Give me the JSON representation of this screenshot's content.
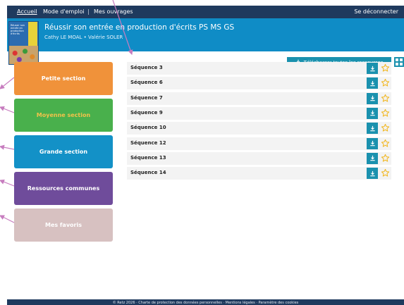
{
  "topnav": {
    "accueil": "Accueil",
    "separator": "|",
    "mode_emploi": "Mode d'emploi",
    "mes_ouvrages": "Mes ouvrages",
    "logout": "Se déconnecter"
  },
  "header": {
    "cover_text": "Réussir son entrée en production d'écrits",
    "title": "Réussir son entrée en production d'écrits PS MS GS",
    "authors": "Cathy LE MOAL • Valérie SOLER"
  },
  "download_all": {
    "label": "Télécharger toutes les ressources",
    "icon": "download-icon"
  },
  "sections": [
    {
      "label": "Petite section",
      "bg": "#f0923a",
      "color": "#ffffff"
    },
    {
      "label": "Moyenne section",
      "bg": "#49b04c",
      "color": "#f2c24a"
    },
    {
      "label": "Grande section",
      "bg": "#1391c7",
      "color": "#ffffff"
    },
    {
      "label": "Ressources communes",
      "bg": "#6f4c9b",
      "color": "#ffffff"
    },
    {
      "label": "Mes favoris",
      "bg": "#d7c1c1",
      "color": "#ffffff"
    }
  ],
  "sequences": [
    {
      "label": "Séquence 3"
    },
    {
      "label": "Séquence 6"
    },
    {
      "label": "Séquence 7"
    },
    {
      "label": "Séquence 9"
    },
    {
      "label": "Séquence 10"
    },
    {
      "label": "Séquence 12"
    },
    {
      "label": "Séquence 13"
    },
    {
      "label": "Séquence 14"
    }
  ],
  "footer": {
    "text": "© Retz 2026 · Charte de protection des données personnelles · Mentions légales · Paramètre des cookies"
  },
  "colors": {
    "nav": "#1f3a5e",
    "header": "#0f8cc6",
    "button": "#1a91ae",
    "star": "#f2b519",
    "annotation_arrow": "#c77dbf"
  }
}
